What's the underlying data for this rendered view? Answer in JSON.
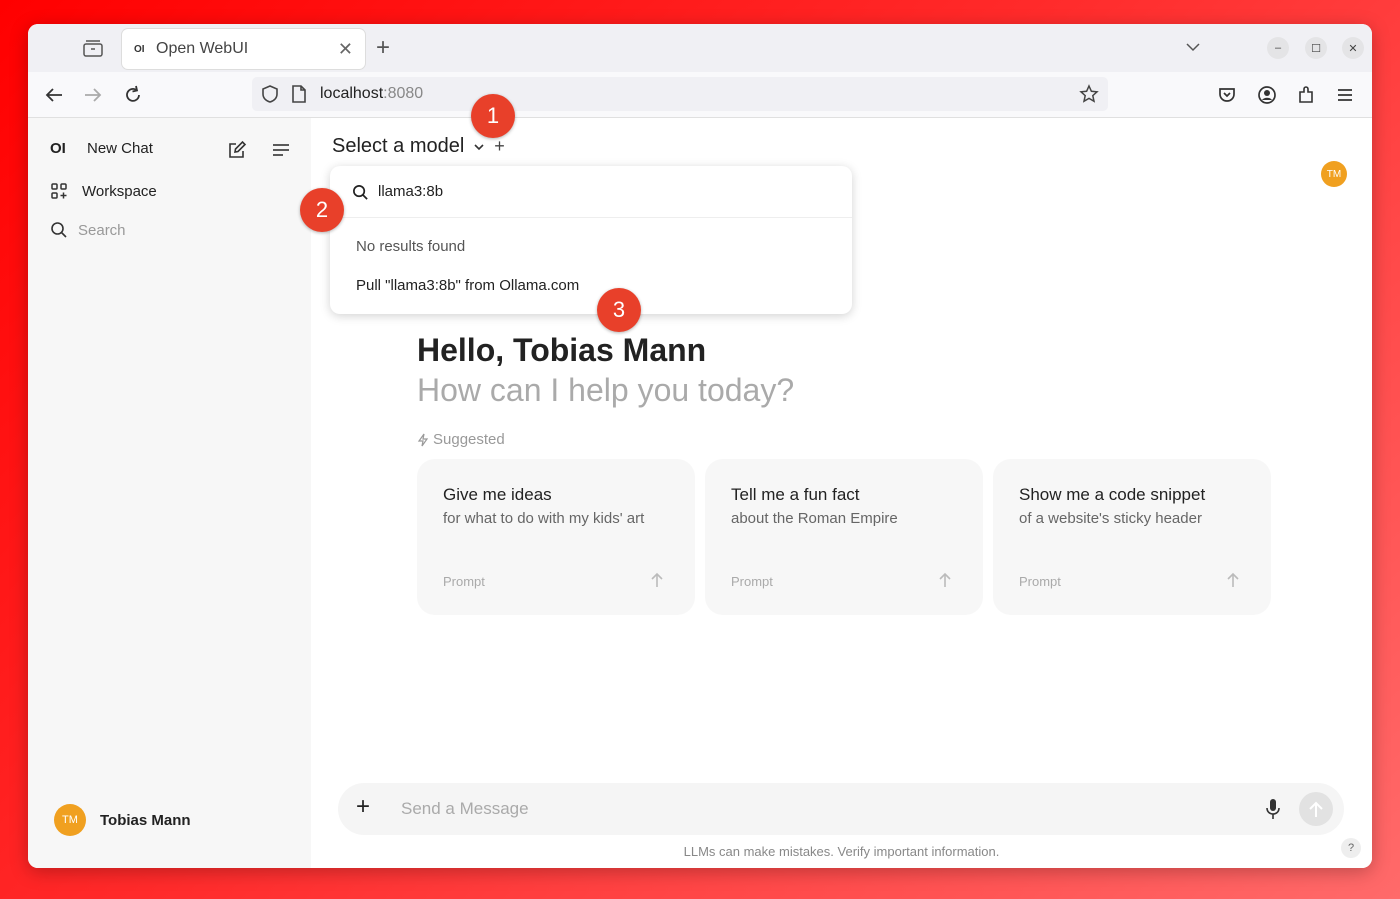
{
  "browser": {
    "tab_title": "Open WebUI",
    "tab_favicon": "OI",
    "url_host": "localhost",
    "url_port": ":8080"
  },
  "sidebar": {
    "logo": "OI",
    "new_chat": "New Chat",
    "workspace": "Workspace",
    "search_placeholder": "Search",
    "user_initials": "TM",
    "user_name": "Tobias Mann"
  },
  "header": {
    "model_select": "Select a model",
    "plus": "+",
    "user_initials": "TM"
  },
  "dropdown": {
    "search_value": "llama3:8b",
    "no_results": "No results found",
    "pull_option": "Pull \"llama3:8b\" from Ollama.com"
  },
  "callouts": [
    "1",
    "2",
    "3"
  ],
  "greeting": {
    "hello": "Hello, Tobias Mann",
    "subtitle": "How can I help you today?",
    "suggested": "Suggested"
  },
  "cards": [
    {
      "title": "Give me ideas",
      "subtitle": "for what to do with my kids' art",
      "prompt": "Prompt"
    },
    {
      "title": "Tell me a fun fact",
      "subtitle": "about the Roman Empire",
      "prompt": "Prompt"
    },
    {
      "title": "Show me a code snippet",
      "subtitle": "of a website's sticky header",
      "prompt": "Prompt"
    }
  ],
  "composer": {
    "placeholder": "Send a Message",
    "disclaimer": "LLMs can make mistakes. Verify important information.",
    "help": "?"
  },
  "colors": {
    "callout": "#e8402a",
    "avatar": "#f0a020"
  }
}
